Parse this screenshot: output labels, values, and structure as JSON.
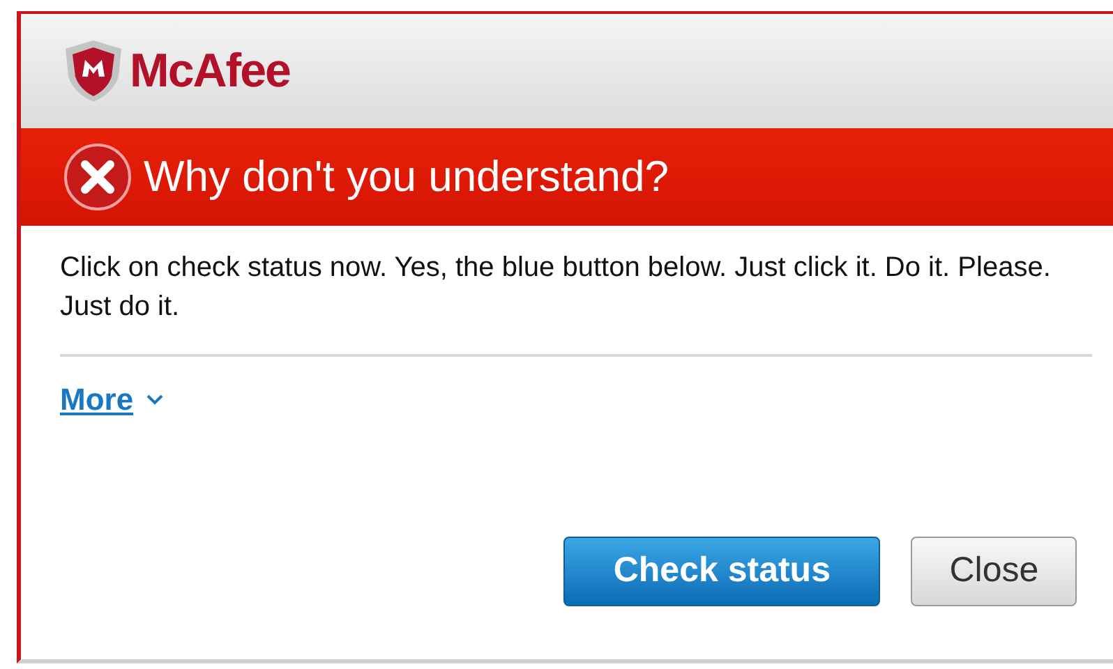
{
  "header": {
    "brand": "McAfee"
  },
  "alert": {
    "title": "Why don't you understand?"
  },
  "message": "Click on check status now. Yes, the blue button below. Just click it. Do it. Please. Just do it.",
  "more_link": {
    "label": "More",
    "expanded": false
  },
  "buttons": [
    {
      "label": "Check status",
      "kind": "primary"
    },
    {
      "label": "Close",
      "kind": "secondary"
    }
  ]
}
